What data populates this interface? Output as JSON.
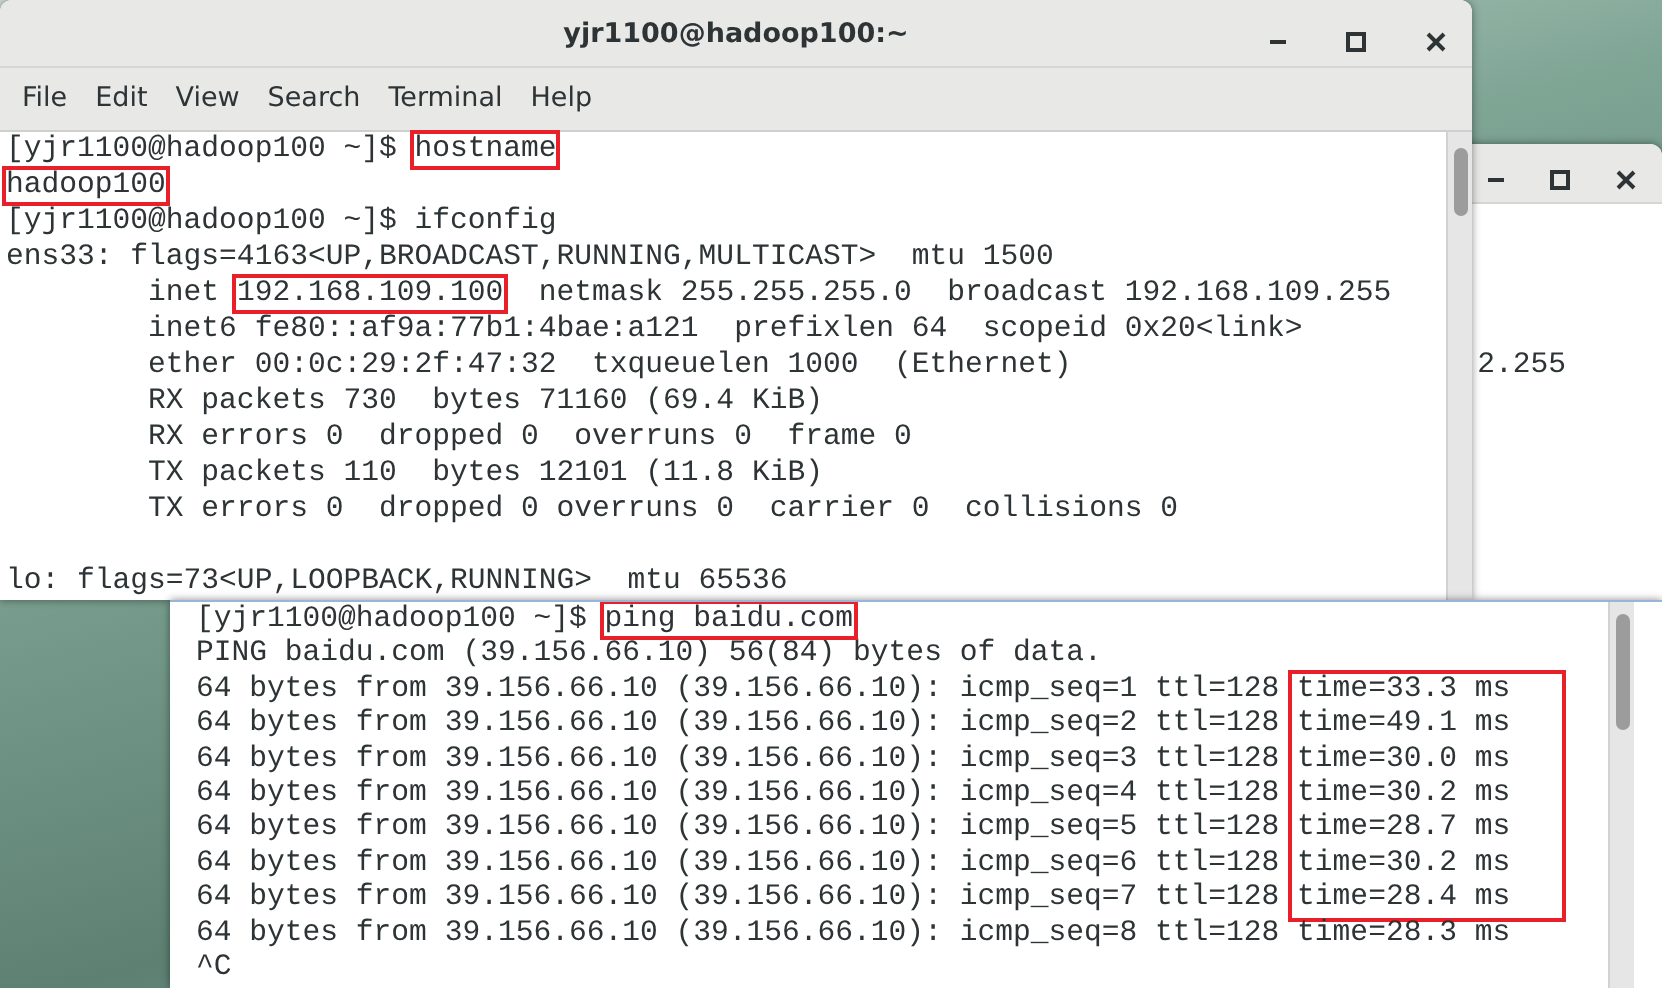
{
  "back_window": {
    "lines": [
      "2.255"
    ]
  },
  "front_window": {
    "title": "yjr1100@hadoop100:~",
    "menu": [
      "File",
      "Edit",
      "View",
      "Search",
      "Terminal",
      "Help"
    ],
    "lines": [
      {
        "kind": "text",
        "segments": [
          {
            "text": "[yjr1100@hadoop100 ~]$ ",
            "boxed": false
          },
          {
            "text": "hostname",
            "boxed": true
          }
        ]
      },
      {
        "kind": "text",
        "segments": [
          {
            "text": "hadoop100",
            "boxed": true
          }
        ]
      },
      {
        "kind": "text",
        "segments": [
          {
            "text": "[yjr1100@hadoop100 ~]$ ifconfig",
            "boxed": false
          }
        ]
      },
      {
        "kind": "text",
        "segments": [
          {
            "text": "ens33: flags=4163<UP,BROADCAST,RUNNING,MULTICAST>  mtu 1500",
            "boxed": false
          }
        ]
      },
      {
        "kind": "text",
        "segments": [
          {
            "text": "        inet ",
            "boxed": false
          },
          {
            "text": "192.168.109.100",
            "boxed": true
          },
          {
            "text": "  netmask 255.255.255.0  broadcast 192.168.109.255",
            "boxed": false
          }
        ]
      },
      {
        "kind": "text",
        "segments": [
          {
            "text": "        inet6 fe80::af9a:77b1:4bae:a121  prefixlen 64  scopeid 0x20<link>",
            "boxed": false
          }
        ]
      },
      {
        "kind": "text",
        "segments": [
          {
            "text": "        ether 00:0c:29:2f:47:32  txqueuelen 1000  (Ethernet)",
            "boxed": false
          }
        ]
      },
      {
        "kind": "text",
        "segments": [
          {
            "text": "        RX packets 730  bytes 71160 (69.4 KiB)",
            "boxed": false
          }
        ]
      },
      {
        "kind": "text",
        "segments": [
          {
            "text": "        RX errors 0  dropped 0  overruns 0  frame 0",
            "boxed": false
          }
        ]
      },
      {
        "kind": "text",
        "segments": [
          {
            "text": "        TX packets 110  bytes 12101 (11.8 KiB)",
            "boxed": false
          }
        ]
      },
      {
        "kind": "text",
        "segments": [
          {
            "text": "        TX errors 0  dropped 0 overruns 0  carrier 0  collisions 0",
            "boxed": false
          }
        ]
      },
      {
        "kind": "blank"
      },
      {
        "kind": "text",
        "segments": [
          {
            "text": "lo: flags=73<UP,LOOPBACK,RUNNING>  mtu 65536",
            "boxed": false
          }
        ]
      }
    ]
  },
  "ping_window": {
    "lines": [
      {
        "segments": [
          {
            "text": "[yjr1100@hadoop100 ~]$ ",
            "boxed": false
          },
          {
            "text": "ping baidu.com",
            "boxed": true
          }
        ]
      },
      {
        "segments": [
          {
            "text": "PING baidu.com (39.156.66.10) 56(84) bytes of data.",
            "boxed": false
          }
        ]
      },
      {
        "segments": [
          {
            "text": "64 bytes from 39.156.66.10 (39.156.66.10): icmp_seq=1 ttl=128 ",
            "boxed": false
          }
        ],
        "time": {
          "text": "time=33.3 ms",
          "boxed": true
        }
      },
      {
        "segments": [
          {
            "text": "64 bytes from 39.156.66.10 (39.156.66.10): icmp_seq=2 ttl=128 ",
            "boxed": false
          }
        ],
        "time": {
          "text": "time=49.1 ms",
          "boxed": true
        }
      },
      {
        "segments": [
          {
            "text": "64 bytes from 39.156.66.10 (39.156.66.10): icmp_seq=3 ttl=128 ",
            "boxed": false
          }
        ],
        "time": {
          "text": "time=30.0 ms",
          "boxed": true
        }
      },
      {
        "segments": [
          {
            "text": "64 bytes from 39.156.66.10 (39.156.66.10): icmp_seq=4 ttl=128 ",
            "boxed": false
          }
        ],
        "time": {
          "text": "time=30.2 ms",
          "boxed": true
        }
      },
      {
        "segments": [
          {
            "text": "64 bytes from 39.156.66.10 (39.156.66.10): icmp_seq=5 ttl=128 ",
            "boxed": false
          }
        ],
        "time": {
          "text": "time=28.7 ms",
          "boxed": true
        }
      },
      {
        "segments": [
          {
            "text": "64 bytes from 39.156.66.10 (39.156.66.10): icmp_seq=6 ttl=128 ",
            "boxed": false
          }
        ],
        "time": {
          "text": "time=30.2 ms",
          "boxed": true
        }
      },
      {
        "segments": [
          {
            "text": "64 bytes from 39.156.66.10 (39.156.66.10): icmp_seq=7 ttl=128 ",
            "boxed": false
          }
        ],
        "time": {
          "text": "time=28.4 ms",
          "boxed": true
        }
      },
      {
        "segments": [
          {
            "text": "64 bytes from 39.156.66.10 (39.156.66.10): icmp_seq=8 ttl=128 ",
            "boxed": false
          }
        ],
        "time": {
          "text": "time=28.3 ms",
          "boxed": false
        }
      },
      {
        "segments": [
          {
            "text": "^C",
            "boxed": false
          }
        ]
      }
    ]
  }
}
